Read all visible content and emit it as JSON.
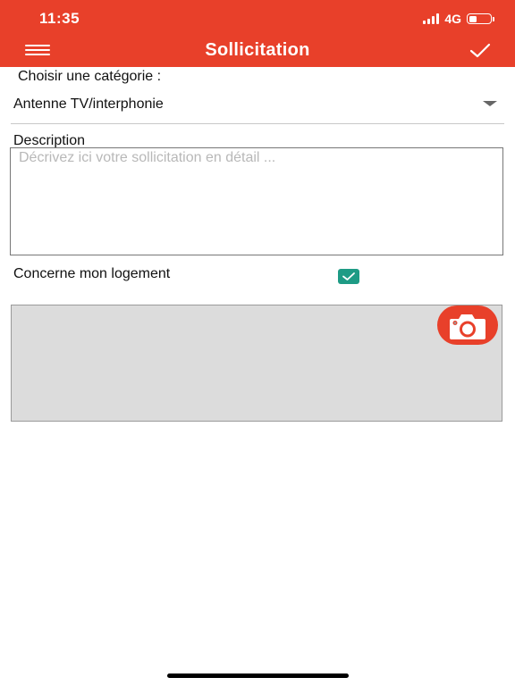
{
  "status_bar": {
    "time": "11:35",
    "network": "4G",
    "battery_level": 0.4
  },
  "header": {
    "title": "Sollicitation",
    "menu_icon": "hamburger-icon",
    "confirm_icon": "check-icon",
    "background": "#e8402a"
  },
  "form": {
    "category_label": "Choisir une catégorie :",
    "category_value": "Antenne TV/interphonie",
    "description_label": "Description",
    "description_placeholder": "Décrivez ici votre sollicitation en détail ...",
    "description_value": "",
    "housing_label": "Concerne mon logement",
    "housing_checked": true,
    "checkbox_color": "#1e9b85"
  },
  "photo": {
    "camera_icon": "camera-icon"
  }
}
